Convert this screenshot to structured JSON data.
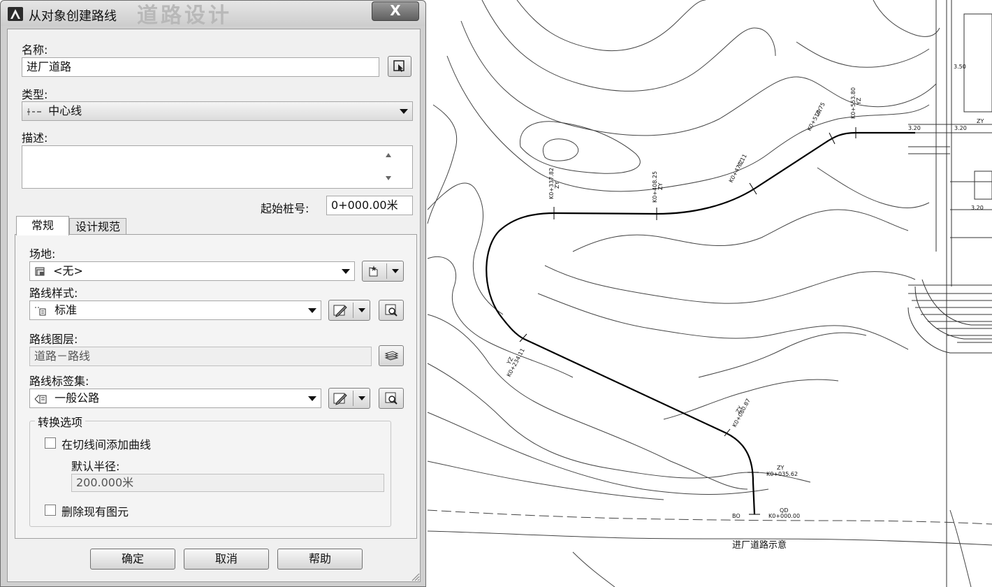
{
  "dialog": {
    "title": "从对象创建路线",
    "title_ghost": "道路设计",
    "close_label": "X",
    "name_label": "名称:",
    "name_value": "进厂道路",
    "type_label": "类型:",
    "type_value": "中心线",
    "desc_label": "描述:",
    "desc_value": "",
    "station_label": "起始桩号:",
    "station_value": "0+000.00米",
    "tabs": [
      {
        "label": "常规",
        "active": true
      },
      {
        "label": "设计规范",
        "active": false
      }
    ],
    "general": {
      "site_label": "场地:",
      "site_value": "<无>",
      "style_label": "路线样式:",
      "style_value": "标准",
      "layer_label": "路线图层:",
      "layer_value": "道路－路线",
      "labelset_label": "路线标签集:",
      "labelset_value": "一般公路",
      "conversion_group_title": "转换选项",
      "add_curves_label": "在切线间添加曲线",
      "add_curves_checked": false,
      "radius_label": "默认半径:",
      "radius_value": "200.000米",
      "erase_label": "删除现有图元",
      "erase_checked": false
    },
    "buttons": {
      "ok": "确定",
      "cancel": "取消",
      "help": "帮助"
    }
  },
  "drawing": {
    "caption": "进厂道路示意",
    "station_labels": [
      {
        "text": "K0+337.82",
        "tag": "ZY"
      },
      {
        "text": "K0+408.25",
        "tag": "ZY"
      },
      {
        "text": "K0+477.11",
        "tag": "YZ"
      },
      {
        "text": "K0+514.75",
        "tag": "ZY"
      },
      {
        "text": "K0+553.80",
        "tag": "YZ"
      },
      {
        "text": "K0+234.11",
        "tag": "YZ"
      },
      {
        "text": "K0+080.87",
        "tag": "ZY"
      },
      {
        "text": "K0+035.62",
        "tag": "ZY"
      },
      {
        "text": "K0+000.00",
        "tag": "QD"
      }
    ],
    "small_marks": {
      "bo": "BO",
      "elev_a": "3.50",
      "elev_b": "3.20",
      "elev_c": "3.20",
      "elev_d": "3.20",
      "right_tag": "ZY"
    }
  }
}
